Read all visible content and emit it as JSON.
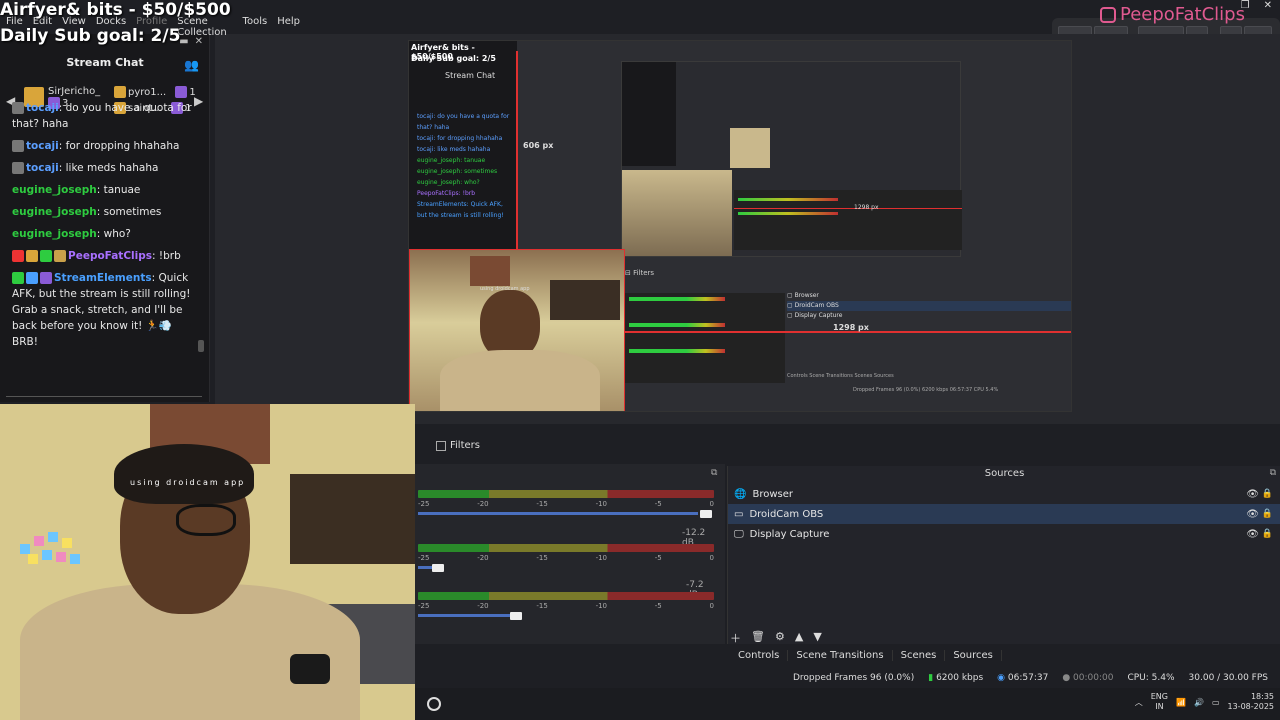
{
  "overlay": {
    "title": "Airfyer& bits - $50/$500",
    "sub_goal": "Daily Sub goal: 2/5",
    "brand": "PeepoFatClips"
  },
  "menu": [
    "File",
    "Edit",
    "View",
    "Docks",
    "Profile",
    "Scene Collection",
    "Tools",
    "Help"
  ],
  "chat": {
    "header": "Stream Chat",
    "subs": [
      {
        "name": "SirJericho_",
        "count": "3"
      },
      {
        "name": "pyro1...",
        "count": "1"
      },
      {
        "name": "saint...",
        "count": "1"
      }
    ],
    "messages": [
      {
        "user": "tocaji",
        "text": "do you have a quota for that? haha"
      },
      {
        "user": "tocaji",
        "text": "for dropping hhahaha"
      },
      {
        "user": "tocaji",
        "text": "like meds hahaha"
      },
      {
        "user": "eugine_joseph",
        "text": "tanuae"
      },
      {
        "user": "eugine_joseph",
        "text": "sometimes"
      },
      {
        "user": "eugine_joseph",
        "text": "who?"
      },
      {
        "user": "PeepoFatClips",
        "text": "!brb"
      },
      {
        "user": "StreamElements",
        "text": "Quick AFK, but the stream is still rolling! Grab a snack, stretch, and I'll be back before you know it! 🏃💨 BRB!"
      }
    ]
  },
  "preview": {
    "width_px_label": "606 px",
    "height_px_label": "1298 px",
    "cam_caption": "using droidcam app"
  },
  "filters_label": "Filters",
  "mixer": {
    "scale": [
      "-25",
      "-20",
      "-15",
      "-10",
      "-5",
      "0"
    ],
    "channels": [
      {
        "db": "-12.2 dB",
        "fader": 0.95
      },
      {
        "db": "-7.2 dB",
        "fader": 0.08
      },
      {
        "db": "",
        "fader": 0.33
      }
    ]
  },
  "sources": {
    "title": "Sources",
    "items": [
      {
        "label": "Browser",
        "icon": "browser-icon"
      },
      {
        "label": "DroidCam OBS",
        "icon": "camera-icon"
      },
      {
        "label": "Display Capture",
        "icon": "monitor-icon"
      }
    ]
  },
  "dock_tabs": [
    "Controls",
    "Scene Transitions",
    "Scenes",
    "Sources"
  ],
  "status": {
    "dropped": "Dropped Frames 96 (0.0%)",
    "bitrate": "6200 kbps",
    "stream_time": "06:57:37",
    "rec_time": "00:00:00",
    "cpu": "CPU: 5.4%",
    "fps": "30.00 / 30.00 FPS"
  },
  "taskbar": {
    "lang": "ENG",
    "region": "IN",
    "time": "18:35",
    "date": "13-08-2025"
  }
}
